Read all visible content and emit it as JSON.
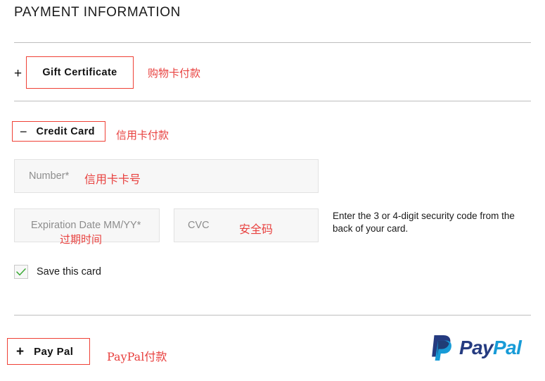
{
  "header": {
    "title": "PAYMENT INFORMATION"
  },
  "colors": {
    "accent_red": "#ef4136",
    "annotation_red": "#e8413f",
    "divider": "#bdbdbd",
    "field_bg": "#f7f7f7",
    "field_border": "#e2e2e2",
    "placeholder": "#8d8d8d",
    "paypal_dark_blue": "#253b80",
    "paypal_light_blue": "#179bd7",
    "check_green": "#3aaa35"
  },
  "sections": {
    "gift_certificate": {
      "toggle_sign": "+",
      "label": "Gift Certificate",
      "annotation": "购物卡付款"
    },
    "credit_card": {
      "toggle_sign": "−",
      "label": "Credit Card",
      "annotation": "信用卡付款",
      "fields": {
        "number": {
          "placeholder": "Number*",
          "value": "",
          "annotation": "信用卡卡号"
        },
        "expiration": {
          "placeholder": "Expiration Date MM/YY*",
          "value": "",
          "annotation": "过期时间"
        },
        "cvc": {
          "placeholder": "CVC",
          "value": "",
          "annotation": "安全码"
        }
      },
      "security_hint": "Enter the 3 or 4-digit security code from the back of your card.",
      "save_card": {
        "label": "Save this card",
        "checked": true,
        "check_glyph": "check-mark"
      }
    },
    "paypal": {
      "toggle_sign": "+",
      "label": "Pay Pal",
      "annotation": "PayPal付款",
      "logo": {
        "icon_name": "paypal-monogram-icon",
        "word_1": "Pay",
        "word_2": "Pal"
      }
    }
  }
}
